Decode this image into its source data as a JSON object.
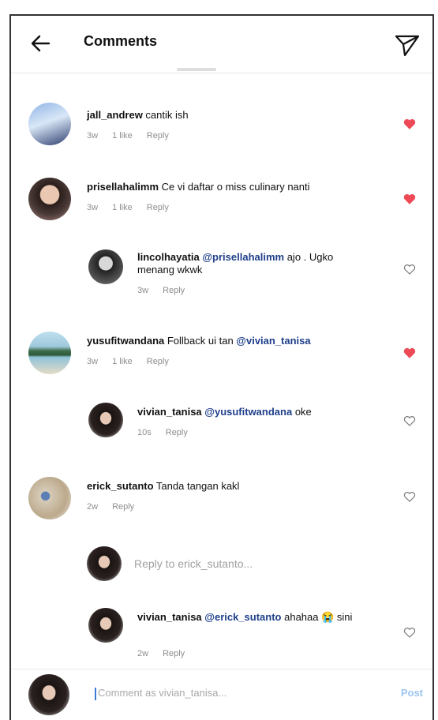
{
  "header": {
    "title": "Comments"
  },
  "comments": [
    {
      "username": "jall_andrew",
      "text": " cantik ish",
      "time": "3w",
      "likes": "1 like",
      "reply": "Reply",
      "liked": true
    },
    {
      "username": "prisellahalimm",
      "text": " Ce vi daftar o miss culinary nanti",
      "time": "3w",
      "likes": "1 like",
      "reply": "Reply",
      "liked": true
    },
    {
      "username": "lincolhayatia",
      "mention": "@prisellahalimm",
      "text": " ajo . Ugko menang wkwk",
      "time": "3w",
      "reply": "Reply",
      "liked": false
    },
    {
      "username": "yusufitwandana",
      "text": " Follback ui tan ",
      "mention": "@vivian_tanisa",
      "time": "3w",
      "likes": "1 like",
      "reply": "Reply",
      "liked": true
    },
    {
      "username": "vivian_tanisa",
      "mention": "@yusufitwandana",
      "text": " oke",
      "time": "10s",
      "reply": "Reply",
      "liked": false
    },
    {
      "username": "erick_sutanto",
      "text": " Tanda tangan kakl",
      "time": "2w",
      "reply": "Reply",
      "liked": false
    },
    {
      "username": "vivian_tanisa",
      "mention": "@erick_sutanto",
      "text": " ahahaa 😭 sini",
      "time": "2w",
      "reply": "Reply",
      "liked": false
    }
  ],
  "reply_input": {
    "placeholder": "Reply to erick_sutanto..."
  },
  "bottom_bar": {
    "placeholder": "Comment as vivian_tanisa...",
    "post_label": "Post"
  },
  "colors": {
    "heart_liked": "#ed4956",
    "mention": "#1e3f8a",
    "post": "#9cc6f2"
  }
}
